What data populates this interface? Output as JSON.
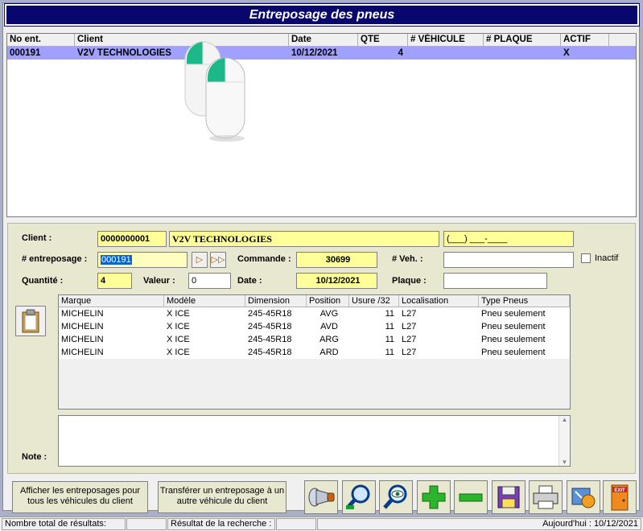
{
  "window": {
    "title": "Entreposage des pneus"
  },
  "list": {
    "headers": [
      "No ent.",
      "Client",
      "Date",
      "QTE",
      "# VÉHICULE",
      "# PLAQUE",
      "ACTIF"
    ],
    "rows": [
      {
        "no": "000191",
        "client": "V2V TECHNOLOGIES",
        "date": "10/12/2021",
        "qte": "4",
        "vehicule": "",
        "plaque": "",
        "actif": "X"
      }
    ]
  },
  "form": {
    "client_label": "Client :",
    "client_code": "0000000001",
    "client_name": "V2V TECHNOLOGIES",
    "client_phone": "(___) ___-____",
    "entreposage_label": "# entreposage :",
    "entreposage_value": "000191",
    "commande_label": "Commande :",
    "commande_value": "30699",
    "veh_label": "# Veh. :",
    "veh_value": "",
    "inactif_label": "Inactif",
    "quantite_label": "Quantité :",
    "quantite_value": "4",
    "valeur_label": "Valeur :",
    "valeur_value": "0",
    "date_label": "Date :",
    "date_value": "10/12/2021",
    "plaque_label": "Plaque :",
    "plaque_value": "",
    "note_label": "Note :"
  },
  "tires": {
    "headers": [
      "Marque",
      "Modèle",
      "Dimension",
      "Position",
      "Usure /32",
      "Localisation",
      "Type Pneus"
    ],
    "rows": [
      {
        "marque": "MICHELIN",
        "modele": "X ICE",
        "dimension": "245-45R18",
        "position": "AVG",
        "usure": "11",
        "localisation": "L27",
        "type": "Pneu seulement"
      },
      {
        "marque": "MICHELIN",
        "modele": "X ICE",
        "dimension": "245-45R18",
        "position": "AVD",
        "usure": "11",
        "localisation": "L27",
        "type": "Pneu seulement"
      },
      {
        "marque": "MICHELIN",
        "modele": "X ICE",
        "dimension": "245-45R18",
        "position": "ARG",
        "usure": "11",
        "localisation": "L27",
        "type": "Pneu seulement"
      },
      {
        "marque": "MICHELIN",
        "modele": "X ICE",
        "dimension": "245-45R18",
        "position": "ARD",
        "usure": "11",
        "localisation": "L27",
        "type": "Pneu seulement"
      }
    ]
  },
  "buttons": {
    "afficher": "Afficher les entreposages pour tous les véhicules du client",
    "transferer": "Transférer un entreposage à un autre véhicule du client",
    "exit_label": "EXIT"
  },
  "status": {
    "total_label": "Nombre total de résultats:",
    "total_value": "",
    "search_label": "Résultat de la recherche :",
    "search_value": "",
    "today": "Aujourd'hui : 10/12/2021"
  },
  "colors": {
    "title_bg": "#07076e",
    "selected_row": "#a0a0ff",
    "yellow_field": "#ffff99",
    "panel": "#e8e8d0"
  }
}
